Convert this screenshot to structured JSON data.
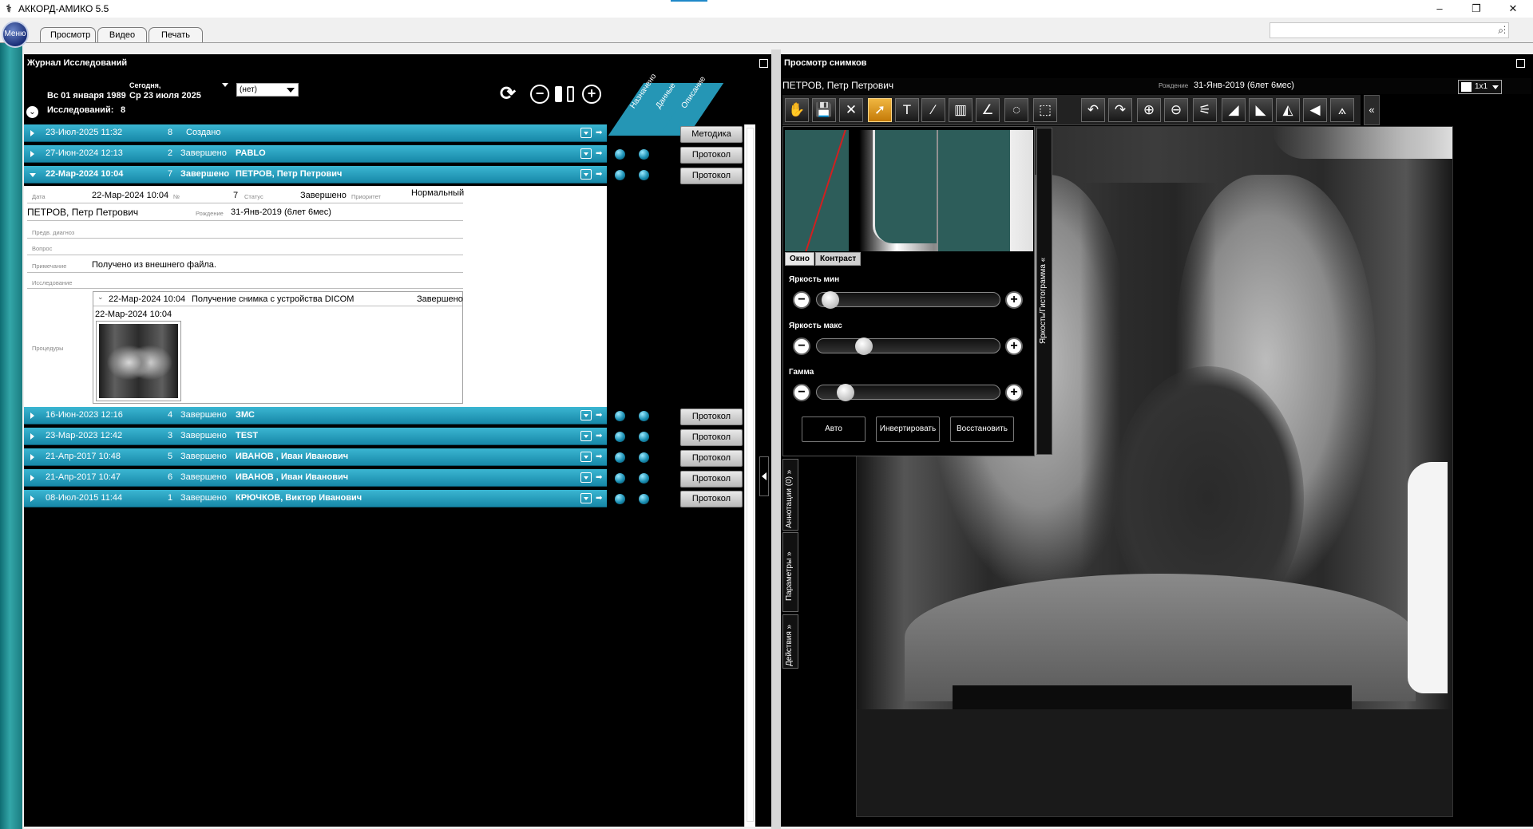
{
  "window": {
    "title": "АККОРД-АМИКО 5.5",
    "minimize": "–",
    "maximize": "❐",
    "close": "✕",
    "icon": "xray-app-icon"
  },
  "menu": {
    "orb_label": "Меню",
    "tabs": [
      "Просмотр",
      "Видео",
      "Печать"
    ],
    "search_icons": "⌕⋮"
  },
  "journal": {
    "title": "Журнал Исследований",
    "date_from": "Вс 01 января 1989",
    "today_label": "Сегодня,",
    "date_to": "Ср 23 июля 2025",
    "filter_value": "(нет)",
    "count_label": "Исследований:",
    "count_value": "8",
    "header_tabs": [
      "Назначено",
      "Данные",
      "Описание"
    ],
    "icons": {
      "refresh": "⟳",
      "zoom_out": "−",
      "zoom_in": "+"
    },
    "rows": [
      {
        "date": "23-Июл-2025 11:32",
        "num": "8",
        "status": "Создано",
        "patient": "",
        "button": "Методика",
        "dots": false
      },
      {
        "date": "27-Июн-2024 12:13",
        "num": "2",
        "status": "Завершено",
        "patient": "PABLO",
        "button": "Протокол",
        "dots": true
      },
      {
        "date": "22-Мар-2024 10:04",
        "num": "7",
        "status": "Завершено",
        "patient": "ПЕТРОВ, Петр Петрович",
        "button": "Протокол",
        "dots": true
      },
      {
        "date": "16-Июн-2023 12:16",
        "num": "4",
        "status": "Завершено",
        "patient": "ЗМС",
        "button": "Протокол",
        "dots": true
      },
      {
        "date": "23-Мар-2023 12:42",
        "num": "3",
        "status": "Завершено",
        "patient": "TEST",
        "button": "Протокол",
        "dots": true
      },
      {
        "date": "21-Апр-2017 10:48",
        "num": "5",
        "status": "Завершено",
        "patient": "ИВАНОВ , Иван Иванович",
        "button": "Протокол",
        "dots": true
      },
      {
        "date": "21-Апр-2017 10:47",
        "num": "6",
        "status": "Завершено",
        "patient": "ИВАНОВ , Иван Иванович",
        "button": "Протокол",
        "dots": true
      },
      {
        "date": "08-Июл-2015 11:44",
        "num": "1",
        "status": "Завершено",
        "patient": "КРЮЧКОВ, Виктор Иванович",
        "button": "Протокол",
        "dots": true
      }
    ],
    "detail": {
      "date_label": "Дата",
      "date": "22-Мар-2024 10:04",
      "num_label": "№",
      "num": "7",
      "status_label": "Статус",
      "status": "Завершено",
      "priority_label": "Приоритет",
      "priority": "Нормальный",
      "patient": "ПЕТРОВ, Петр Петрович",
      "birth_label": "Рождение",
      "birth": "31-Янв-2019 (6лет 6мес)",
      "prelim_label": "Предв. диагноз",
      "question_label": "Вопрос",
      "note_label": "Примечание",
      "note": "Получено из внешнего файла.",
      "study_label": "Исследование",
      "procedures_label": "Процедуры",
      "proc_date": "22-Мар-2024 10:04",
      "proc_name": "Получение снимка с устройства DICOM",
      "proc_status": "Завершено",
      "image_date": "22-Мар-2024 10:04"
    }
  },
  "viewer": {
    "title": "Просмотр снимков",
    "patient": "ПЕТРОВ, Петр Петрович",
    "birth_label": "Рождение",
    "birth": "31-Янв-2019 (6лет 6мес)",
    "layout": "1x1",
    "collapse_icon": "«",
    "toolbar": [
      {
        "name": "hand-icon",
        "glyph": "✋"
      },
      {
        "name": "save-icon",
        "glyph": "💾"
      },
      {
        "name": "close-icon",
        "glyph": "✕"
      },
      {
        "name": "pointer-icon",
        "glyph": "➚"
      },
      {
        "name": "text-icon",
        "glyph": "T"
      },
      {
        "name": "line-icon",
        "glyph": "⁄"
      },
      {
        "name": "ruler-icon",
        "glyph": "▥"
      },
      {
        "name": "angle-icon",
        "glyph": "∠"
      },
      {
        "name": "shape-icon",
        "glyph": "◌"
      },
      {
        "name": "roi-icon",
        "glyph": "⬚"
      },
      {
        "name": "rotate-left-icon",
        "glyph": "↶"
      },
      {
        "name": "rotate-right-icon",
        "glyph": "↷"
      },
      {
        "name": "zoom-in-icon",
        "glyph": "⊕"
      },
      {
        "name": "zoom-out-icon",
        "glyph": "⊖"
      },
      {
        "name": "wand-icon",
        "glyph": "⚟"
      },
      {
        "name": "brightness-icon",
        "glyph": "◢"
      },
      {
        "name": "contrast-icon",
        "glyph": "◣"
      },
      {
        "name": "flip-icon",
        "glyph": "◭"
      },
      {
        "name": "invert-icon",
        "glyph": "◀"
      },
      {
        "name": "measure-icon",
        "glyph": "⟑"
      }
    ],
    "histogram": {
      "tabs": [
        "Окно",
        "Контраст"
      ],
      "sliders": [
        {
          "label": "Яркость мин",
          "level": 0.03
        },
        {
          "label": "Яркость макс",
          "level": 0.23
        },
        {
          "label": "Гамма",
          "level": 0.12
        }
      ],
      "buttons": [
        "Авто",
        "Инвертировать",
        "Восстановить"
      ],
      "side_tab": "Яркость/Гистограмма «"
    },
    "side_tabs": [
      "Аннотации (0) »",
      "Параметры »",
      "Действия »"
    ]
  }
}
